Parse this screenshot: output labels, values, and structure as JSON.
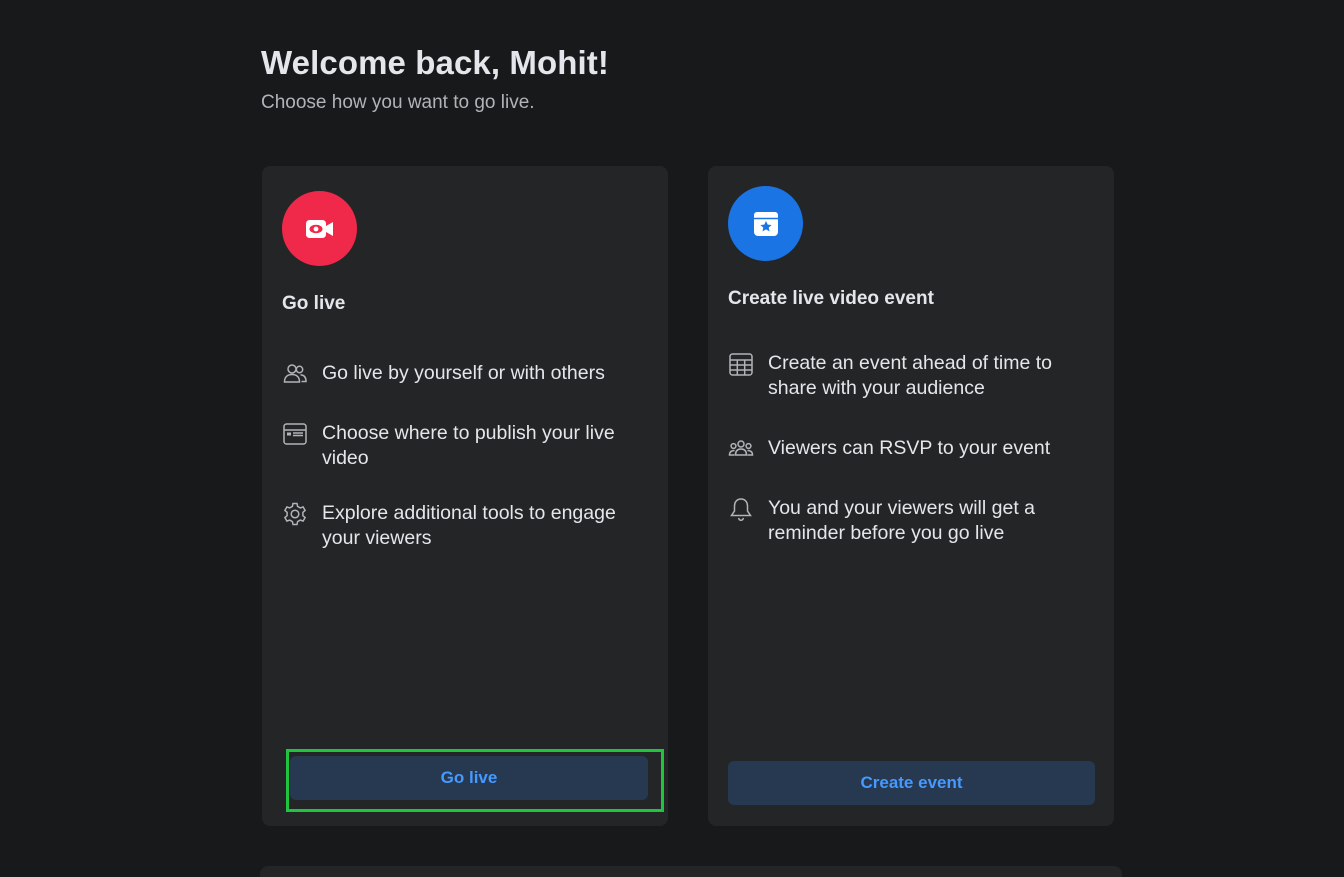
{
  "header": {
    "title": "Welcome back, Mohit!",
    "subtitle": "Choose how you want to go live."
  },
  "go_live_card": {
    "icon": "video-camera-icon",
    "icon_color": "#f02849",
    "title": "Go live",
    "features": [
      {
        "icon": "people-icon",
        "text": "Go live by yourself or with others"
      },
      {
        "icon": "browser-window-icon",
        "text": "Choose where to publish your live video"
      },
      {
        "icon": "gear-icon",
        "text": "Explore additional tools to engage your viewers"
      }
    ],
    "button_label": "Go live"
  },
  "event_card": {
    "icon": "calendar-star-icon",
    "icon_color": "#1b74e4",
    "title": "Create live video event",
    "features": [
      {
        "icon": "calendar-grid-icon",
        "text": "Create an event ahead of time to share with your audience"
      },
      {
        "icon": "group-icon",
        "text": "Viewers can RSVP to your event"
      },
      {
        "icon": "bell-icon",
        "text": "You and your viewers will get a reminder before you go live"
      }
    ],
    "button_label": "Create event"
  },
  "colors": {
    "background": "#18191a",
    "card": "#242526",
    "button_bg": "#263951",
    "button_text": "#4599ff",
    "highlight": "#1fc43f"
  }
}
